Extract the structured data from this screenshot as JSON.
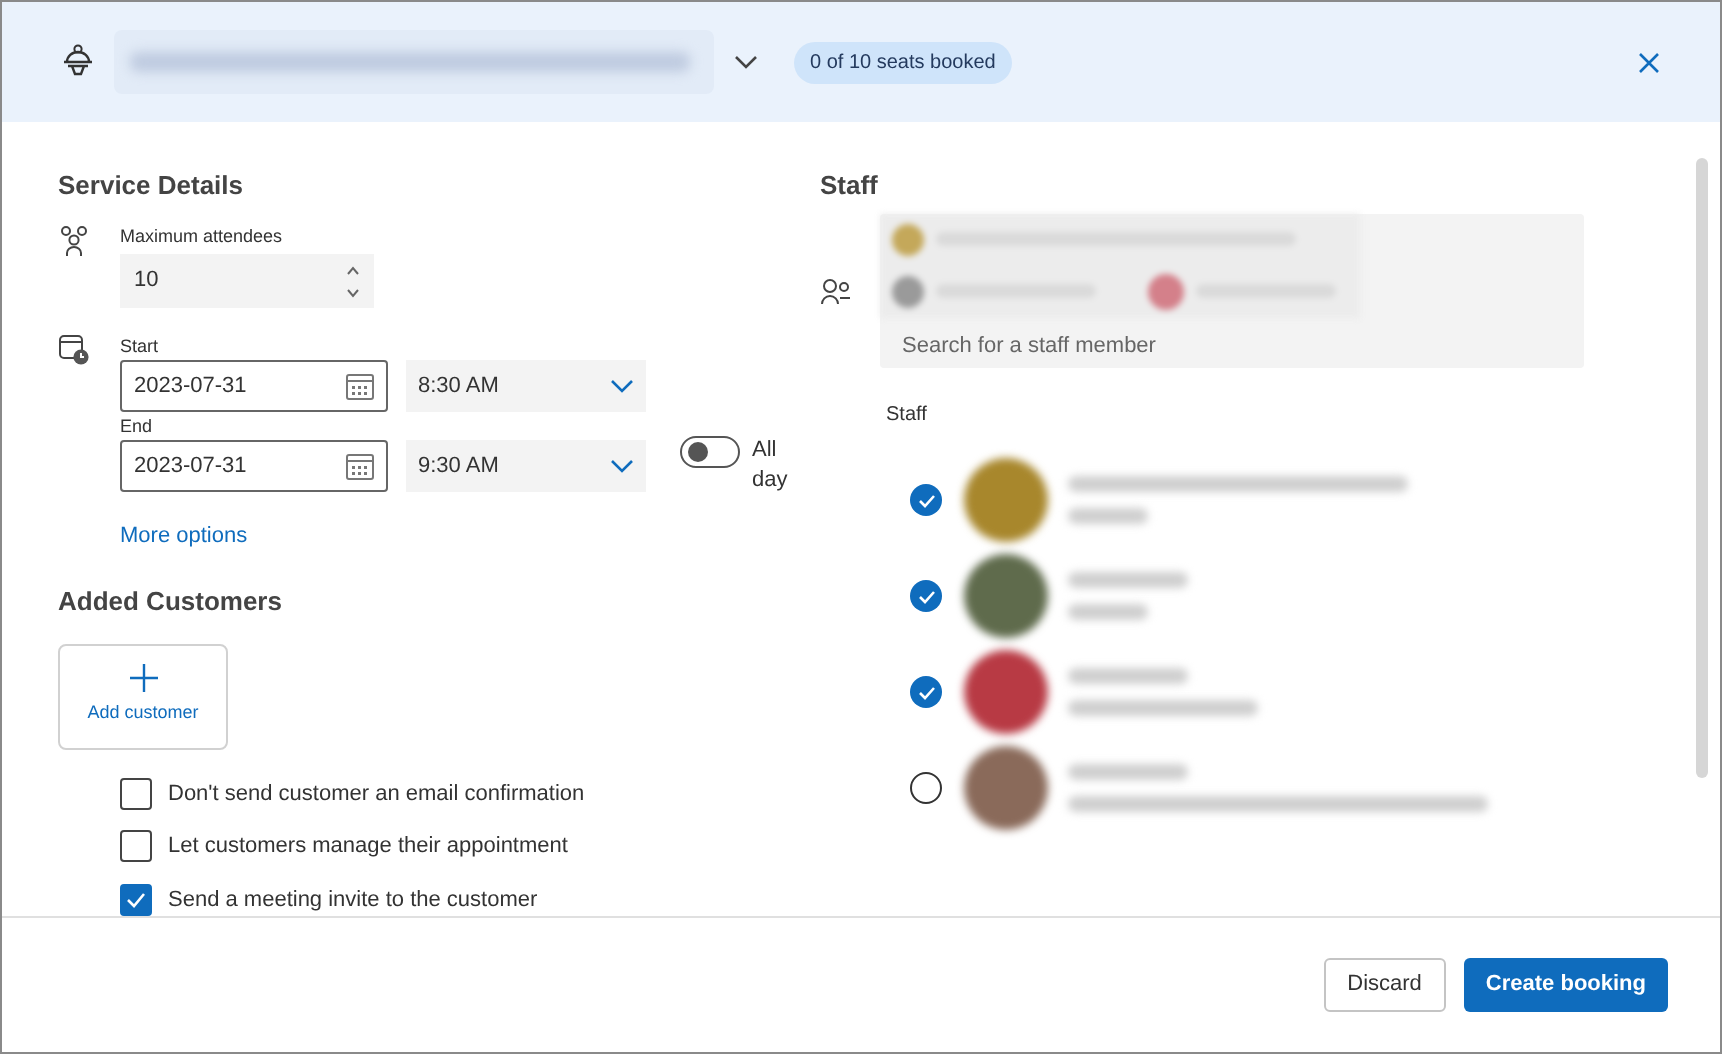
{
  "header": {
    "seats_badge": "0 of 10 seats booked"
  },
  "service_details": {
    "title": "Service Details",
    "max_attendees": {
      "label": "Maximum attendees",
      "value": "10"
    },
    "start": {
      "label": "Start",
      "date": "2023-07-31",
      "time": "8:30 AM"
    },
    "end": {
      "label": "End",
      "date": "2023-07-31",
      "time": "9:30 AM"
    },
    "all_day": {
      "label": "All day",
      "on": false
    },
    "more_options": "More options"
  },
  "customers": {
    "title": "Added Customers",
    "add_button": "Add customer",
    "options": [
      {
        "label": "Don't send customer an email confirmation",
        "checked": false
      },
      {
        "label": "Let customers manage their appointment",
        "checked": false
      },
      {
        "label": "Send a meeting invite to the customer",
        "checked": true
      }
    ]
  },
  "staff": {
    "title": "Staff",
    "search": {
      "placeholder": "Search for a staff member"
    },
    "list_label": "Staff",
    "members": [
      {
        "checked": true,
        "color": "#a8872c"
      },
      {
        "checked": true,
        "color": "#5f6b4c"
      },
      {
        "checked": true,
        "color": "#b83a44"
      },
      {
        "checked": false,
        "color": "#8a6a5a"
      }
    ]
  },
  "footer": {
    "buttons": [
      {
        "label": "Discard",
        "kind": "secondary"
      },
      {
        "label": "Create booking",
        "kind": "primary"
      }
    ]
  }
}
